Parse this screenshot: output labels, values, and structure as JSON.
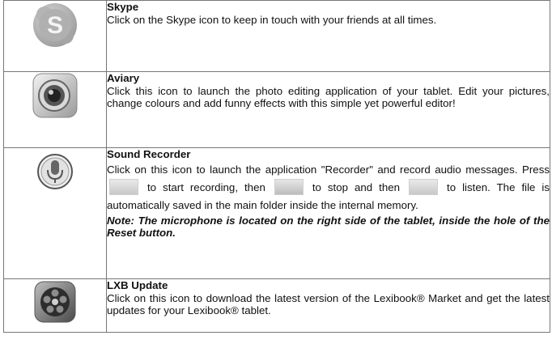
{
  "rows": [
    {
      "title": "Skype",
      "icon": "skype-icon",
      "text": "Click on the Skype icon to keep in touch with your friends at all times."
    },
    {
      "title": "Aviary",
      "icon": "aviary-camera-lens-icon",
      "text": "Click this icon to launch the photo editing application of your tablet. Edit your pictures, change colours and add funny effects with this simple yet powerful editor!"
    },
    {
      "title": "Sound Recorder",
      "icon": "microphone-icon",
      "text_1": "Click on this icon to launch the application \"Recorder\" and record audio messages. Press",
      "text_2": "to start recording, then",
      "text_3": "to stop and then",
      "text_4": "to listen. The file is automatically saved in the main folder inside the internal memory.",
      "note": "Note: The microphone is located on the right side of the tablet, inside the hole of the Reset button.",
      "inline_icons": [
        "record-button-icon",
        "stop-button-icon",
        "play-button-icon"
      ]
    },
    {
      "title": "LXB Update",
      "icon": "film-reel-update-icon",
      "text": "Click on this icon to download the latest version of the Lexibook® Market and get the latest updates for your Lexibook® tablet."
    }
  ]
}
